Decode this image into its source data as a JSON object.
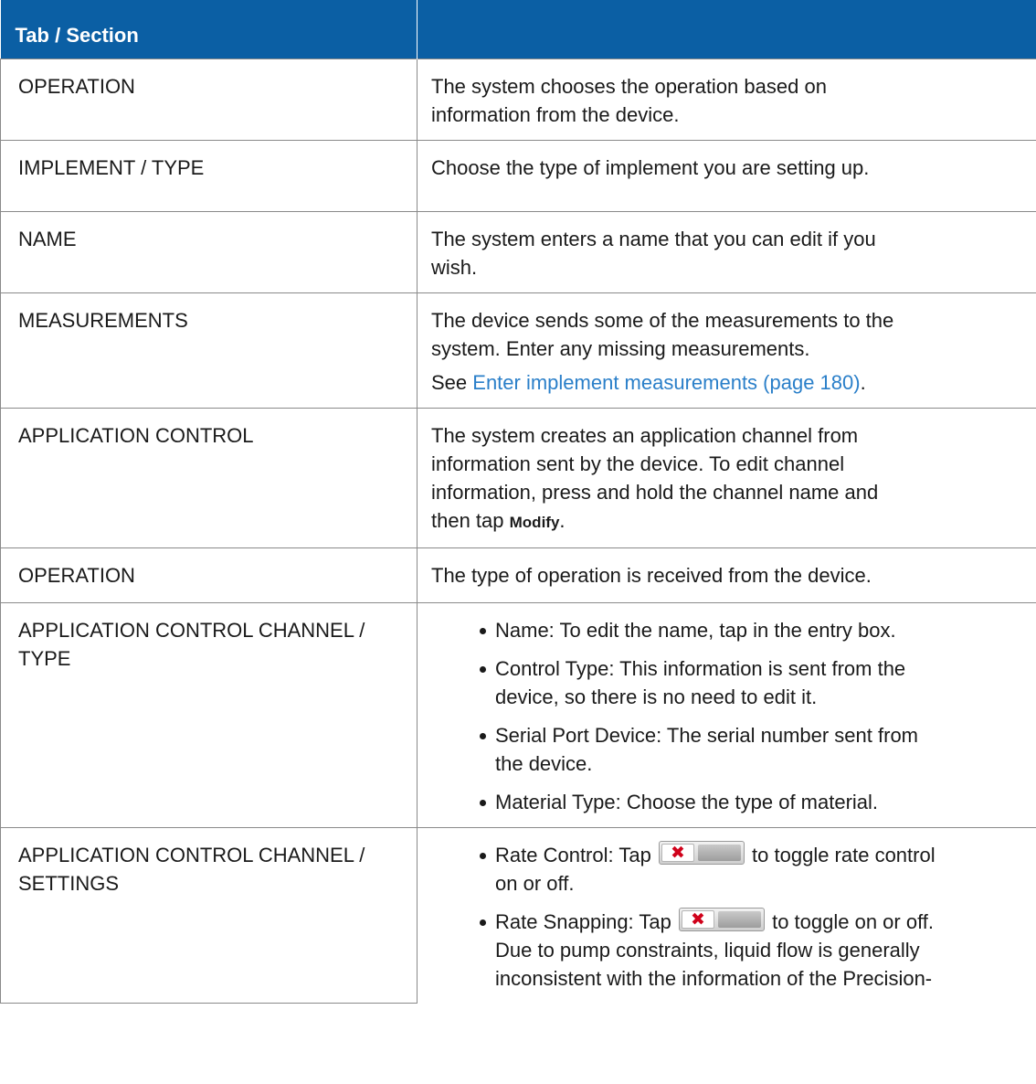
{
  "header": {
    "col1": "Tab / Section",
    "col2": ""
  },
  "rows": [
    {
      "label": [
        "OPERATION"
      ],
      "desc": [
        "The system chooses the operation based on",
        "information from the device."
      ]
    },
    {
      "label": [
        "IMPLEMENT / TYPE"
      ],
      "desc": [
        "Choose the type of implement you are setting up."
      ]
    },
    {
      "label": [
        "NAME"
      ],
      "desc": [
        "The system enters a name that you can edit if you",
        "wish."
      ]
    },
    {
      "label": [
        "MEASUREMENTS"
      ],
      "desc": [
        "The device sends some of the measurements to the",
        "system. Enter any missing measurements."
      ],
      "see_prefix": "See ",
      "see_link": "Enter implement measurements (page 180)",
      "see_suffix": "."
    },
    {
      "label": [
        "APPLICATION CONTROL"
      ],
      "desc": [
        "The system creates an application channel from",
        "information sent by the device. To edit channel",
        "information, press and hold the channel name and"
      ],
      "last_prefix": "then tap ",
      "last_cmd": "Modify",
      "last_suffix": "."
    },
    {
      "label": [
        "OPERATION"
      ],
      "desc": [
        "The type of operation is received from the device."
      ]
    },
    {
      "label": [
        "APPLICATION CONTROL CHANNEL /",
        "TYPE"
      ],
      "bullets": [
        [
          "Name: To edit the name, tap in the entry box."
        ],
        [
          "Control Type: This information is sent from the",
          "device, so there is no need to edit it."
        ],
        [
          "Serial Port Device: The serial number sent from",
          "the device."
        ],
        [
          "Material Type: Choose the type of material."
        ]
      ]
    },
    {
      "label": [
        "APPLICATION CONTROL CHANNEL /",
        "SETTINGS"
      ],
      "bullet1_before": "Rate Control: Tap ",
      "bullet1_after": " to toggle rate control",
      "bullet1_line2": "on or off.",
      "bullet2_before": "Rate Snapping: Tap ",
      "bullet2_after": " to toggle on or off.",
      "bullet2_lines": [
        "Due to pump constraints, liquid flow is generally",
        "inconsistent with the information of the Precision-"
      ]
    }
  ],
  "toggle": {
    "icon": "toggle-off-switch",
    "glyph": "✖",
    "glyph_color": "#d0021b"
  },
  "colors": {
    "header_bg": "#0b5fa4",
    "link": "#2a7fc9"
  }
}
